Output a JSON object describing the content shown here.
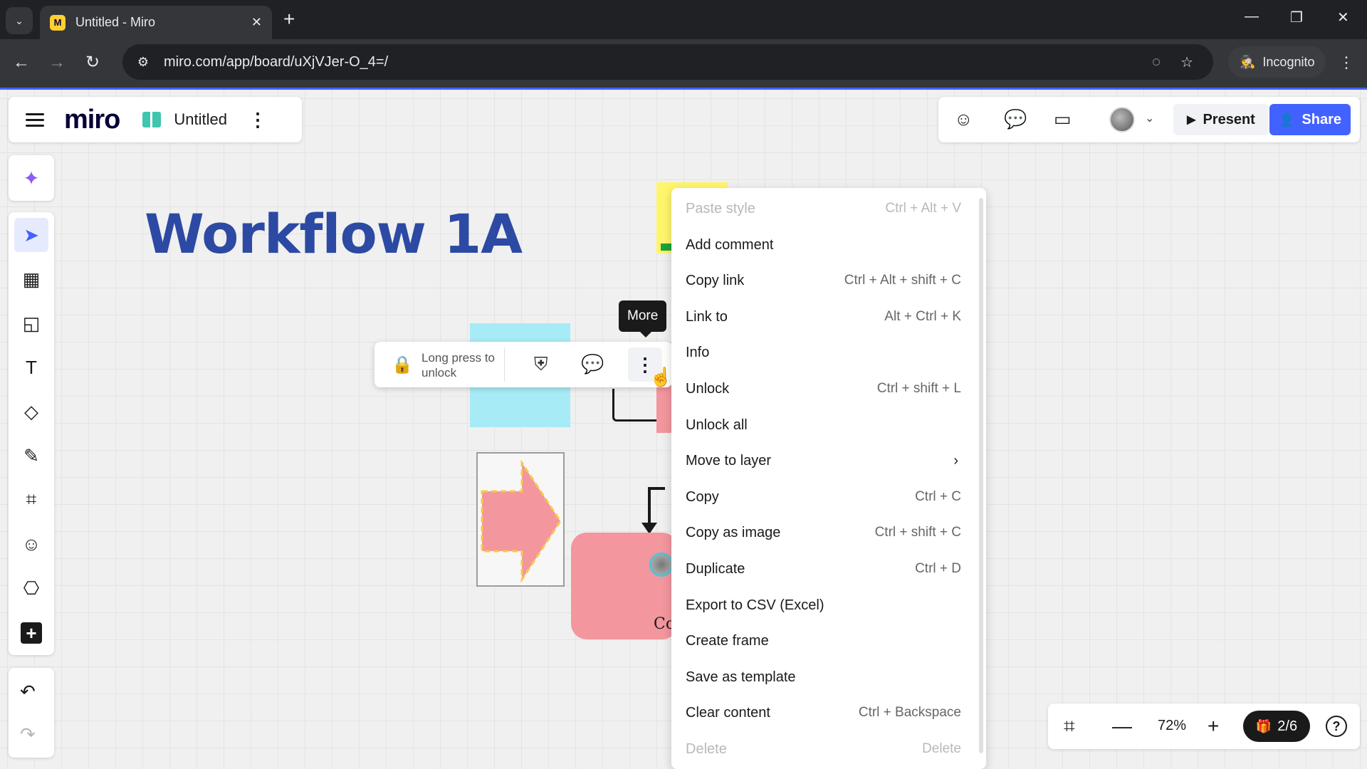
{
  "browser": {
    "tab_title": "Untitled - Miro",
    "tab_favicon_letter": "M",
    "url": "miro.com/app/board/uXjVJer-O_4=/",
    "incognito_label": "Incognito",
    "icons": {
      "tab_search": "⌄",
      "tab_close": "✕",
      "new_tab": "+",
      "minimize": "—",
      "restore": "❐",
      "close": "✕",
      "back": "←",
      "forward": "→",
      "reload": "↻",
      "site_info": "⚙",
      "eye_off": "◌",
      "star": "☆",
      "incognito": "🕵",
      "menu": "⋮"
    }
  },
  "header": {
    "logo": "miro",
    "board_title": "Untitled",
    "more_icon": "⋮",
    "present_label": "Present",
    "present_icon": "▶",
    "share_label": "Share",
    "share_icon": "👤",
    "reactions_icon": "☺",
    "chat_icon": "💬",
    "video_icon": "▭",
    "avatar_caret": "⌄"
  },
  "toolbar": {
    "ai_icon": "✦",
    "tools": [
      {
        "name": "select",
        "icon": "➤"
      },
      {
        "name": "templates",
        "icon": "▦"
      },
      {
        "name": "sticky-note",
        "icon": "◱"
      },
      {
        "name": "text",
        "icon": "T"
      },
      {
        "name": "shapes",
        "icon": "◇"
      },
      {
        "name": "pen",
        "icon": "✎"
      },
      {
        "name": "frame",
        "icon": "⌗"
      },
      {
        "name": "stickers",
        "icon": "☺"
      },
      {
        "name": "diagram",
        "icon": "⎔"
      },
      {
        "name": "more-tools",
        "icon": "+"
      }
    ],
    "undo_icon": "↶",
    "redo_icon": "↷"
  },
  "canvas": {
    "title": "Workflow 1A",
    "card_label": "Co"
  },
  "context_toolbar": {
    "lock_icon": "🔒",
    "unlock_text": "Long press to unlock",
    "shield_icon": "⛨",
    "comment_icon": "💬",
    "more_icon": "⋮",
    "tooltip": "More",
    "cursor_icon": "☝"
  },
  "context_menu": {
    "items": [
      {
        "label": "Paste style",
        "shortcut": "Ctrl + Alt + V",
        "disabled": true
      },
      {
        "label": "Add comment",
        "shortcut": ""
      },
      {
        "label": "Copy link",
        "shortcut": "Ctrl + Alt + shift + C"
      },
      {
        "label": "Link to",
        "shortcut": "Alt + Ctrl + K"
      },
      {
        "label": "Info",
        "shortcut": ""
      },
      {
        "label": "Unlock",
        "shortcut": "Ctrl + shift + L"
      },
      {
        "label": "Unlock all",
        "shortcut": ""
      },
      {
        "label": "Move to layer",
        "shortcut": "",
        "submenu": true
      },
      {
        "label": "Copy",
        "shortcut": "Ctrl + C"
      },
      {
        "label": "Copy as image",
        "shortcut": "Ctrl + shift + C"
      },
      {
        "label": "Duplicate",
        "shortcut": "Ctrl + D"
      },
      {
        "label": "Export to CSV (Excel)",
        "shortcut": ""
      },
      {
        "label": "Create frame",
        "shortcut": ""
      },
      {
        "label": "Save as template",
        "shortcut": ""
      },
      {
        "label": "Clear content",
        "shortcut": "Ctrl + Backspace"
      },
      {
        "label": "Delete",
        "shortcut": "Delete",
        "disabled": true
      }
    ],
    "submenu_icon": "›"
  },
  "footer": {
    "fit_icon": "⌗",
    "zoom_out_icon": "—",
    "zoom_level": "72%",
    "zoom_in_icon": "+",
    "pages_icon": "🎁",
    "pages_label": "2/6",
    "help_icon": "?"
  }
}
